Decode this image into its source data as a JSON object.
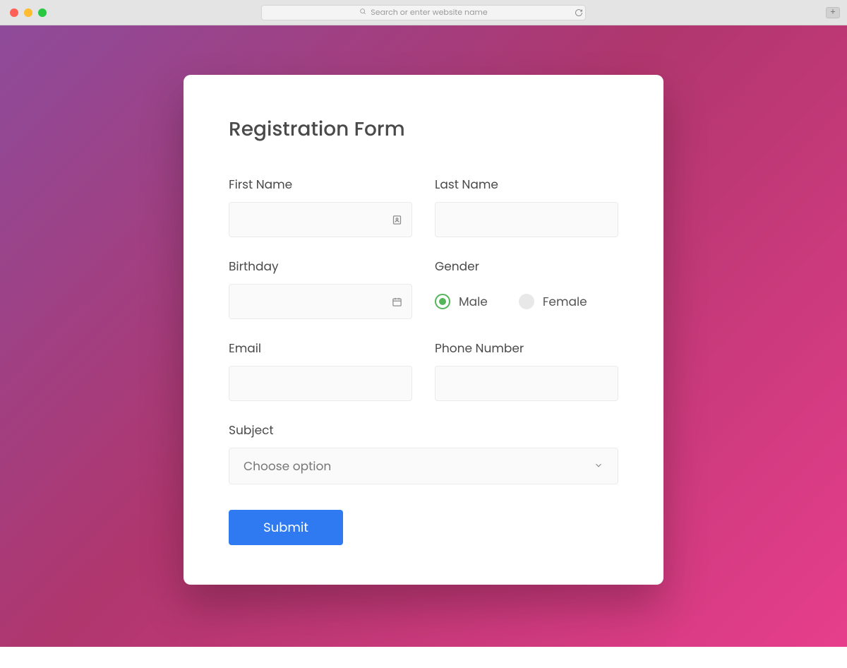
{
  "browser": {
    "address_placeholder": "Search or enter website name"
  },
  "form": {
    "title": "Registration Form",
    "first_name_label": "First Name",
    "last_name_label": "Last Name",
    "birthday_label": "Birthday",
    "gender_label": "Gender",
    "gender_male": "Male",
    "gender_female": "Female",
    "email_label": "Email",
    "phone_label": "Phone Number",
    "subject_label": "Subject",
    "subject_placeholder": "Choose option",
    "submit_label": "Submit"
  },
  "colors": {
    "gradient_start": "#8e4b9a",
    "gradient_end": "#e83e8c",
    "primary_button": "#2f7af0",
    "radio_active": "#55b559"
  }
}
